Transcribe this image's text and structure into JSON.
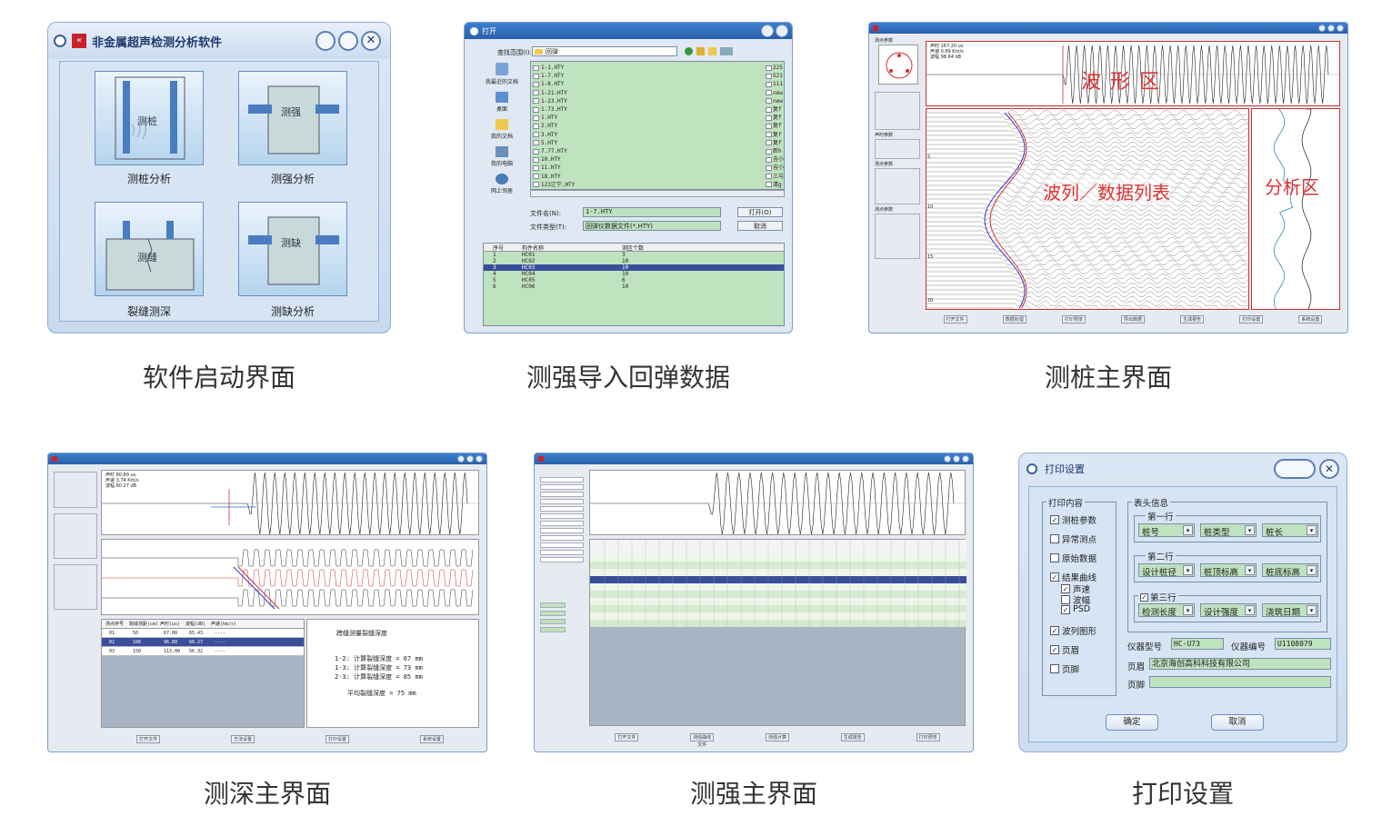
{
  "captions": {
    "p1": "软件启动界面",
    "p2": "测强导入回弹数据",
    "p3": "测桩主界面",
    "p4": "测深主界面",
    "p5": "测强主界面",
    "p6": "打印设置"
  },
  "launcher": {
    "title": "非金属超声检测分析软件",
    "tiles": [
      {
        "icon_label": "测桩",
        "label": "测桩分析"
      },
      {
        "icon_label": "测强",
        "label": "测强分析"
      },
      {
        "icon_label": "测缝",
        "label": "裂缝测深"
      },
      {
        "icon_label": "测缺",
        "label": "测缺分析"
      }
    ]
  },
  "open_dialog": {
    "title": "打开",
    "lookin_label": "查找范围(I):",
    "lookin_value": "回弹",
    "places": [
      "我最近的文档",
      "桌面",
      "我的文档",
      "我的电脑",
      "网上邻居"
    ],
    "files_left": [
      "1-1.HTY",
      "1-7.HTY",
      "1-8.HTY",
      "1-21.HTY",
      "1-23.HTY",
      "1.73.HTY",
      "1.HTY",
      "2.HTY",
      "3.HTY",
      "5.HTY",
      "7.77.HTY",
      "10.HTY",
      "11.HTY",
      "18.HTY",
      "123辽宁.HTY"
    ],
    "files_right": [
      "225",
      "521",
      "111",
      "new",
      "new",
      "复f",
      "复f",
      "复f",
      "复f",
      "复f",
      "新h",
      "吉小",
      "吉小",
      "三与",
      "清g"
    ],
    "filename_label": "文件名(N):",
    "filename_value": "1-7.HTY",
    "filetype_label": "文件类型(T):",
    "filetype_value": "回弹仪数据文件(*.HTY)",
    "open_button": "打开(O)",
    "cancel_button": "取消",
    "table_headers": [
      "序号",
      "构件名称",
      "测区个数"
    ],
    "table_rows": [
      [
        "1",
        "HC01",
        "3"
      ],
      [
        "2",
        "HC02",
        "10"
      ],
      [
        "3",
        "HC03",
        "10"
      ],
      [
        "4",
        "HC04",
        "10"
      ],
      [
        "5",
        "HC05",
        "6"
      ],
      [
        "6",
        "HC06",
        "10"
      ]
    ],
    "selected_row": 2
  },
  "pile_main": {
    "waveform_label": "波形区",
    "list_label": "波列／数据列表",
    "analysis_label": "分析区",
    "wave_info": [
      "声时 167.20 us",
      "声速 0.89 Km/s",
      "波幅 98.64 dB"
    ],
    "param_groups": [
      "测点参数",
      "声时参数",
      "测点参数",
      "测点参数"
    ],
    "depth_ticks": [
      "5",
      "10",
      "15",
      "20"
    ],
    "buttons": [
      "打开文件",
      "数据处理",
      "打印预览",
      "导出数据",
      "生成报告",
      "打印设置",
      "系统设置"
    ]
  },
  "depth_main": {
    "wave_info": [
      "声时 80.80 us",
      "声速 3.74 Km/s",
      "波幅 60.27 dB"
    ],
    "table_headers": [
      "测点序号",
      "跨缝测距(cm)",
      "声时(us)",
      "波幅(dB)",
      "声速(km/s)"
    ],
    "table_rows": [
      [
        "01",
        "50",
        "67.00",
        "65.43",
        "----"
      ],
      [
        "02",
        "100",
        "96.80",
        "60.27",
        "----"
      ],
      [
        "03",
        "150",
        "113.00",
        "56.32",
        "----"
      ]
    ],
    "selected_row": 1,
    "result_title": "跨缝测量裂缝深度",
    "results": [
      "1-2: 计算裂缝深度 =  67 mm",
      "1-3: 计算裂缝深度 =  73 mm",
      "2-3: 计算裂缝深度 =  85 mm"
    ],
    "average": "平均裂缝深度 =  75 mm",
    "buttons": [
      "打开文件",
      "方法设置",
      "打印设置",
      "系统设置"
    ]
  },
  "strength_main": {
    "buttons": [
      "打开文件",
      "测强曲线文件",
      "测强计算",
      "生成报告",
      "打印预览"
    ]
  },
  "print_settings": {
    "title": "打印设置",
    "content_group": "打印内容",
    "content_items": [
      {
        "label": "测桩参数",
        "checked": true
      },
      {
        "label": "异常测点",
        "checked": false
      },
      {
        "label": "原始数据",
        "checked": false
      },
      {
        "label": "结果曲线",
        "checked": true
      }
    ],
    "sub_items": [
      {
        "label": "声速",
        "checked": true
      },
      {
        "label": "波幅",
        "checked": false
      },
      {
        "label": "PSD",
        "checked": true
      }
    ],
    "content_items2": [
      {
        "label": "波列图形",
        "checked": true
      },
      {
        "label": "页眉",
        "checked": true
      },
      {
        "label": "页脚",
        "checked": false
      }
    ],
    "header_group": "表头信息",
    "row1_label": "第一行",
    "row1": [
      "桩号",
      "桩类型",
      "桩长"
    ],
    "row2_label": "第二行",
    "row2": [
      "设计桩径",
      "桩顶标高",
      "桩底标高"
    ],
    "row3_label": "第三行",
    "row3": [
      "检测长度",
      "设计强度",
      "浇筑日期"
    ],
    "instrument_model_label": "仪器型号",
    "instrument_model": "HC-U73",
    "instrument_no_label": "仪器编号",
    "instrument_no": "U1108079",
    "header_label": "页眉",
    "header_value": "北京海创高科科技有限公司",
    "footer_label": "页脚",
    "footer_value": "",
    "ok_button": "确定",
    "cancel_button": "取消"
  }
}
